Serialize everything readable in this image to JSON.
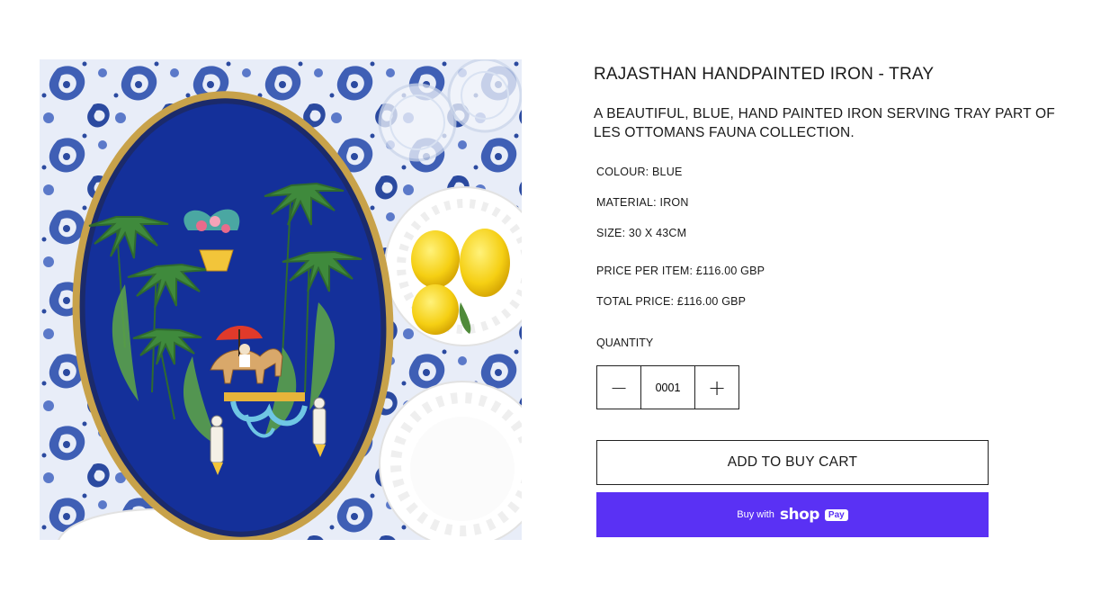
{
  "product": {
    "image_alt": "Blue hand painted iron tray on paisley tablecloth with glasses, lemons and white lace plates",
    "title": "RAJASTHAN HANDPAINTED IRON - TRAY",
    "description": "A BEAUTIFUL, BLUE, HAND PAINTED IRON SERVING TRAY PART OF LES OTTOMANS FAUNA COLLECTION.",
    "colour": "COLOUR: BLUE",
    "material": "MATERIAL: IRON",
    "size": "SIZE: 30 X 43CM",
    "price_per_item": "PRICE PER ITEM: £116.00 GBP",
    "total_price": "TOTAL PRICE: £116.00 GBP"
  },
  "quantity": {
    "label": "QUANTITY",
    "value": "0001",
    "decrement_symbol": "−",
    "increment_symbol": "+"
  },
  "actions": {
    "add_to_cart": "ADD TO BUY CART",
    "buy_with": "Buy with",
    "shop_word": "shop",
    "pay_badge": "Pay"
  },
  "colors": {
    "shop_pay_purple": "#5a31f4",
    "tray_blue": "#14309a",
    "tablecloth_blue": "#3f5fb5"
  }
}
